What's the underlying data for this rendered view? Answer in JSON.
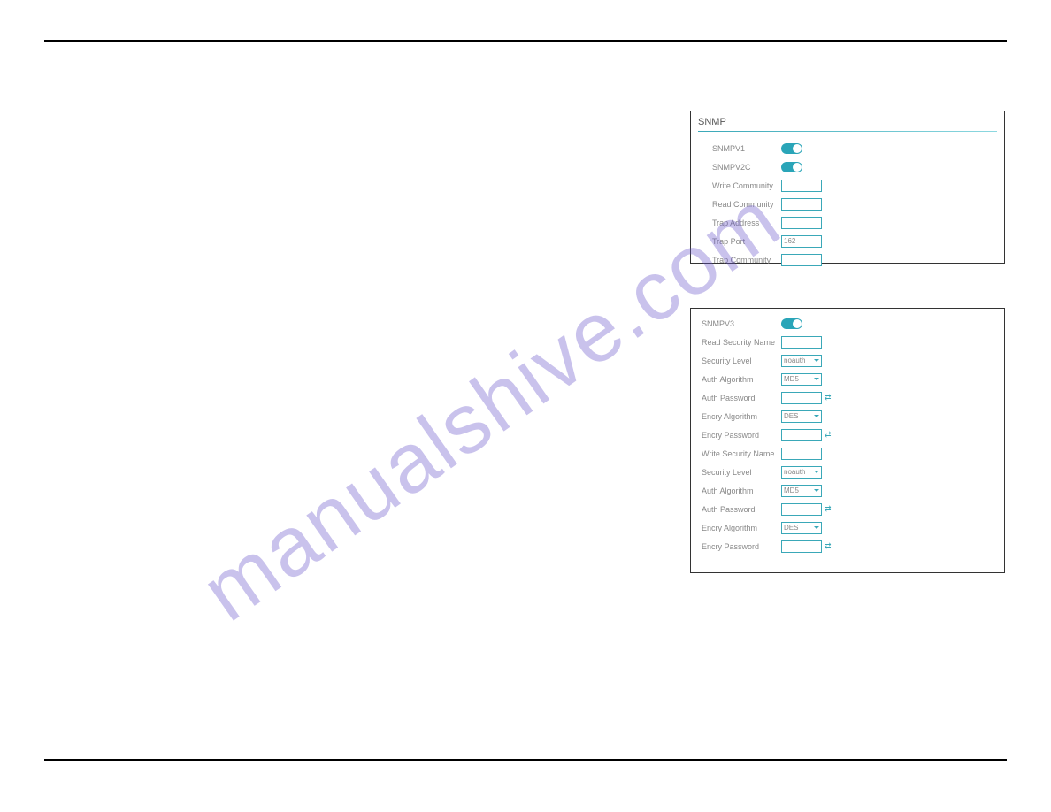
{
  "watermark": "manualshive.com",
  "panel1": {
    "title": "SNMP",
    "snmpv1_label": "SNMPV1",
    "snmpv2c_label": "SNMPV2C",
    "write_community_label": "Write Community",
    "read_community_label": "Read Community",
    "trap_address_label": "Trap Address",
    "trap_port_label": "Trap Port",
    "trap_port_value": "162",
    "trap_community_label": "Trap Community"
  },
  "panel2": {
    "snmpv3_label": "SNMPV3",
    "read_security_name_label": "Read Security Name",
    "security_level_label": "Security Level",
    "security_level_value": "noauth",
    "auth_algorithm_label": "Auth Algorithm",
    "auth_algorithm_value": "MD5",
    "auth_password_label": "Auth Password",
    "encry_algorithm_label": "Encry Algorithm",
    "encry_algorithm_value": "DES",
    "encry_password_label": "Encry Password",
    "write_security_name_label": "Write Security Name",
    "security_level_label2": "Security Level",
    "security_level_value2": "noauth",
    "auth_algorithm_label2": "Auth Algorithm",
    "auth_algorithm_value2": "MD5",
    "auth_password_label2": "Auth Password",
    "encry_algorithm_label2": "Encry Algorithm",
    "encry_algorithm_value2": "DES",
    "encry_password_label2": "Encry Password"
  }
}
